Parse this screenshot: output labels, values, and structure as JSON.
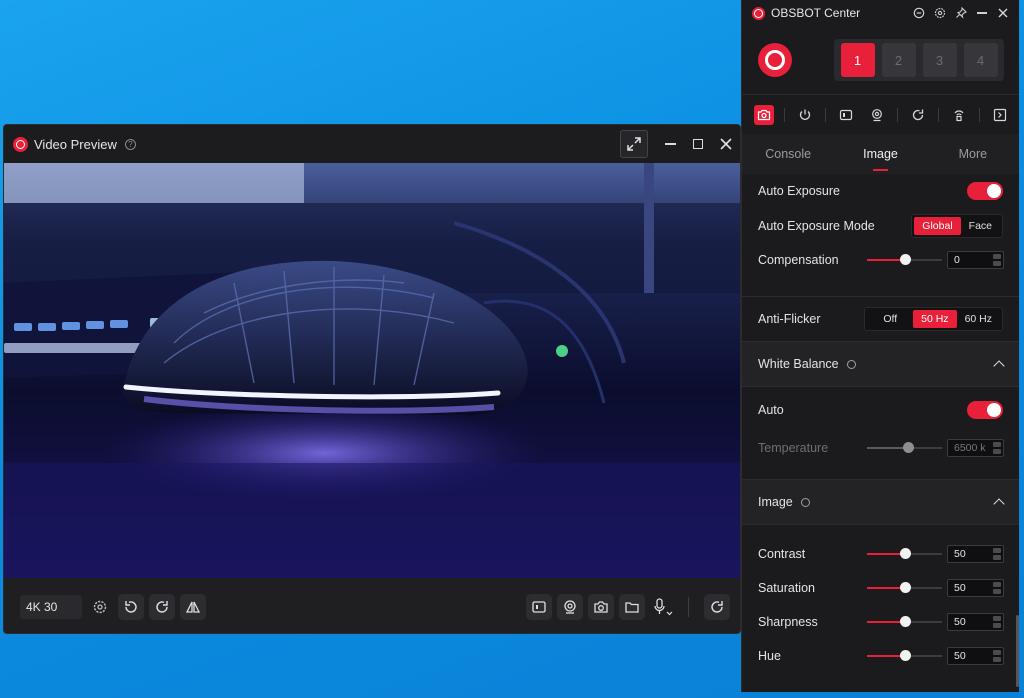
{
  "preview": {
    "title": "Video Preview",
    "help_glyph": "?",
    "resolution": "4K 30"
  },
  "center": {
    "title": "OBSBOT Center",
    "device_slots": [
      "1",
      "2",
      "3",
      "4"
    ],
    "tabs": [
      "Console",
      "Image",
      "More"
    ],
    "active_tab": "Image",
    "exposure": {
      "auto_exposure_label": "Auto Exposure",
      "auto_exposure_on": true,
      "mode_label": "Auto Exposure Mode",
      "mode_options": [
        "Global",
        "Face"
      ],
      "mode_selected": "Global",
      "compensation_label": "Compensation",
      "compensation_value": "0",
      "compensation_fraction": 0.5
    },
    "anti_flicker": {
      "label": "Anti-Flicker",
      "options": [
        "Off",
        "50 Hz",
        "60 Hz"
      ],
      "selected": "50 Hz"
    },
    "white_balance": {
      "section_label": "White Balance",
      "auto_label": "Auto",
      "auto_on": true,
      "temperature_label": "Temperature",
      "temperature_value": "6500 k",
      "temperature_fraction": 0.55
    },
    "image": {
      "section_label": "Image",
      "sliders": [
        {
          "label": "Contrast",
          "value": "50",
          "fraction": 0.5
        },
        {
          "label": "Saturation",
          "value": "50",
          "fraction": 0.5
        },
        {
          "label": "Sharpness",
          "value": "50",
          "fraction": 0.5
        },
        {
          "label": "Hue",
          "value": "50",
          "fraction": 0.5
        }
      ]
    }
  },
  "colors": {
    "accent": "#e8203a",
    "panel_bg": "#1b1b1e",
    "desktop_bg": "#0b8de0"
  }
}
